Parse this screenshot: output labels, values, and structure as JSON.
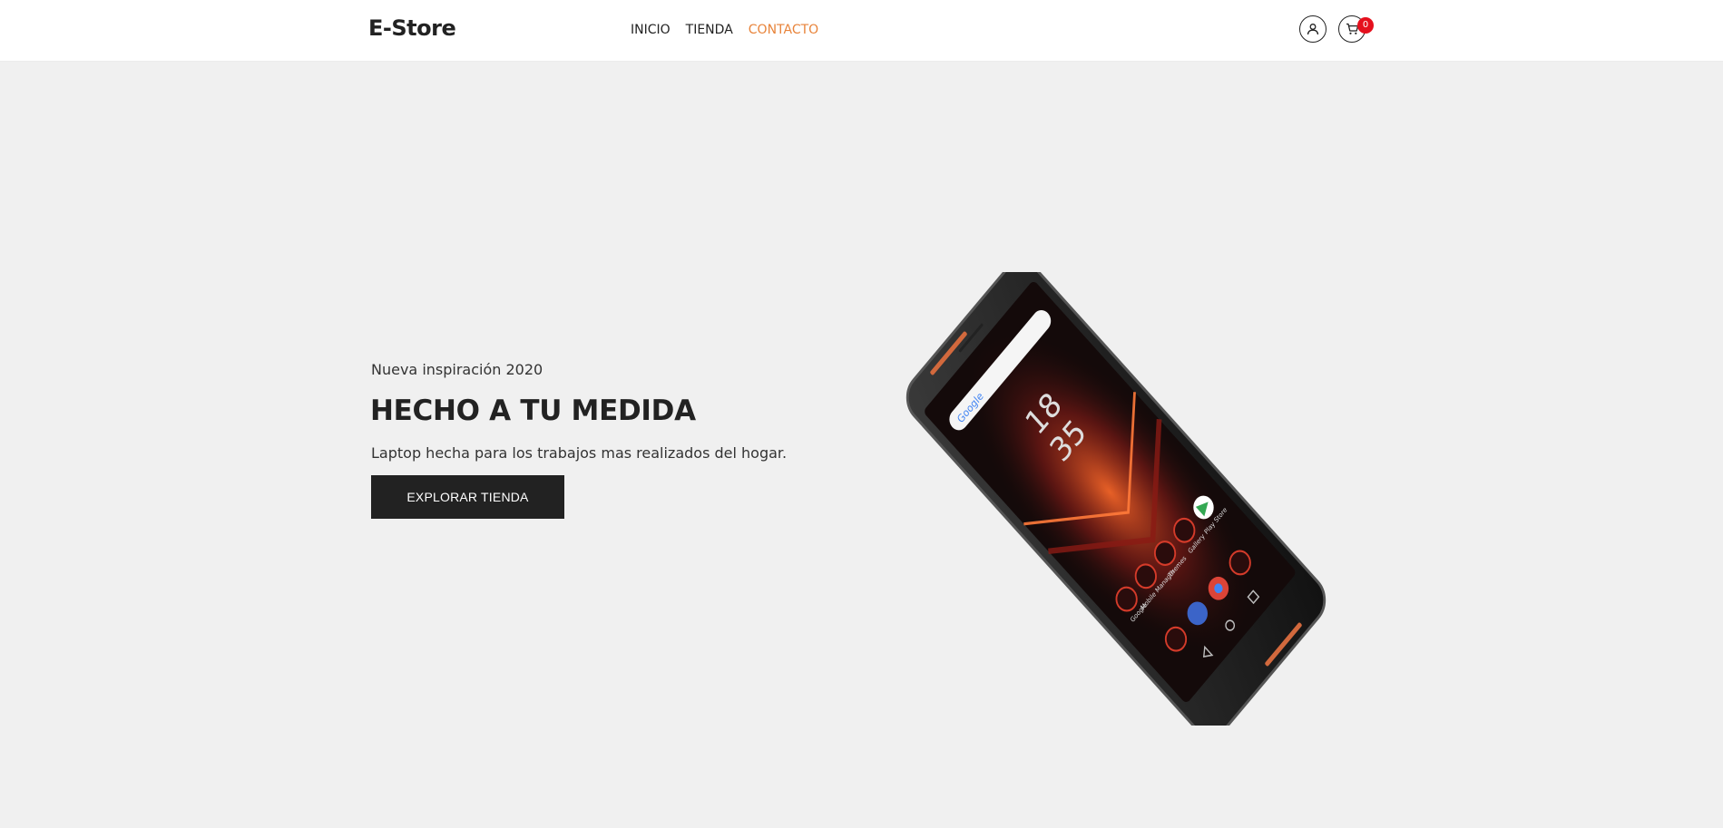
{
  "header": {
    "logo": "E-Store",
    "nav": [
      {
        "label": "INICIO"
      },
      {
        "label": "TIENDA"
      },
      {
        "label": "CONTACTO"
      }
    ],
    "cart_count": "0",
    "accent_color": "#e8843b",
    "badge_color": "#e5101d",
    "icons": [
      "user-icon",
      "cart-icon"
    ]
  },
  "hero": {
    "eyebrow": "Nueva inspiración 2020",
    "headline": "HECHO A TU MEDIDA",
    "subtext": "Laptop hecha para los trabajos mas realizados del hogar.",
    "cta_label": "EXPLORAR TIENDA",
    "background_color": "#f0f0f0",
    "phone_screen": {
      "time_hour": "18",
      "time_minute": "35",
      "search_brand": "Google",
      "apps": [
        "Google",
        "Mobile Manager",
        "Themes",
        "Gallery",
        "Play Store"
      ]
    }
  }
}
